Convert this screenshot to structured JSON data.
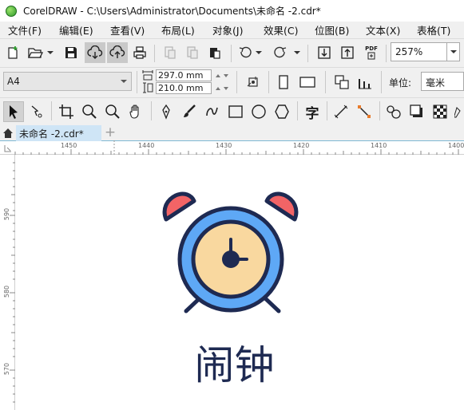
{
  "window": {
    "title": "CorelDRAW - C:\\Users\\Administrator\\Documents\\未命名 -2.cdr*"
  },
  "menu": [
    {
      "label": "文件(F)"
    },
    {
      "label": "编辑(E)"
    },
    {
      "label": "查看(V)"
    },
    {
      "label": "布局(L)"
    },
    {
      "label": "对象(J)"
    },
    {
      "label": "效果(C)"
    },
    {
      "label": "位图(B)"
    },
    {
      "label": "文本(X)"
    },
    {
      "label": "表格(T)"
    }
  ],
  "toolbar": {
    "zoom": "257%",
    "pdf_label": "PDF"
  },
  "property_bar": {
    "page_size": "A4",
    "width": "297.0 mm",
    "height": "210.0 mm",
    "unit_label": "单位:",
    "unit_value": "毫米"
  },
  "toolbox": {
    "text_tool_glyph": "字"
  },
  "tabs": {
    "document": "未命名 -2.cdr*",
    "add": "+"
  },
  "ruler": {
    "top": [
      "1450",
      "1440",
      "1430",
      "1420",
      "1410",
      "1400"
    ],
    "left": [
      "590",
      "580",
      "570"
    ]
  },
  "canvas": {
    "label": "闹钟"
  },
  "colors": {
    "clock_ring": "#5ea8f6",
    "clock_face": "#f9d89f",
    "bells": "#f26466",
    "outline": "#1e2a52"
  }
}
